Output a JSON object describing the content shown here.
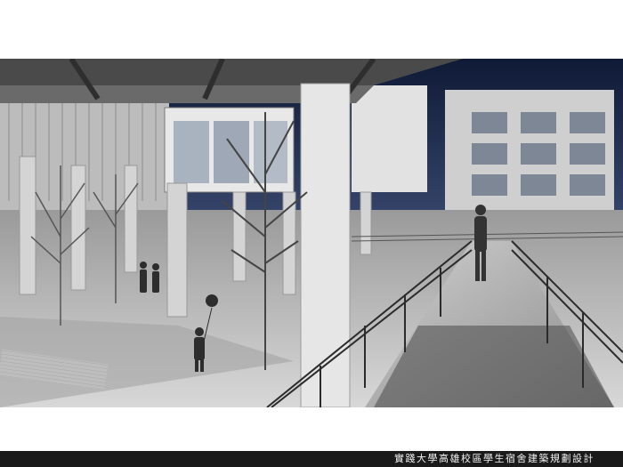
{
  "caption": {
    "title": "實踐大學高雄校區學生宿舍建築規劃設計"
  },
  "render": {
    "description_icon": "architectural-rendering-image",
    "sky_color": "#1d2a4a",
    "ground_color": "#c9c9c9"
  }
}
